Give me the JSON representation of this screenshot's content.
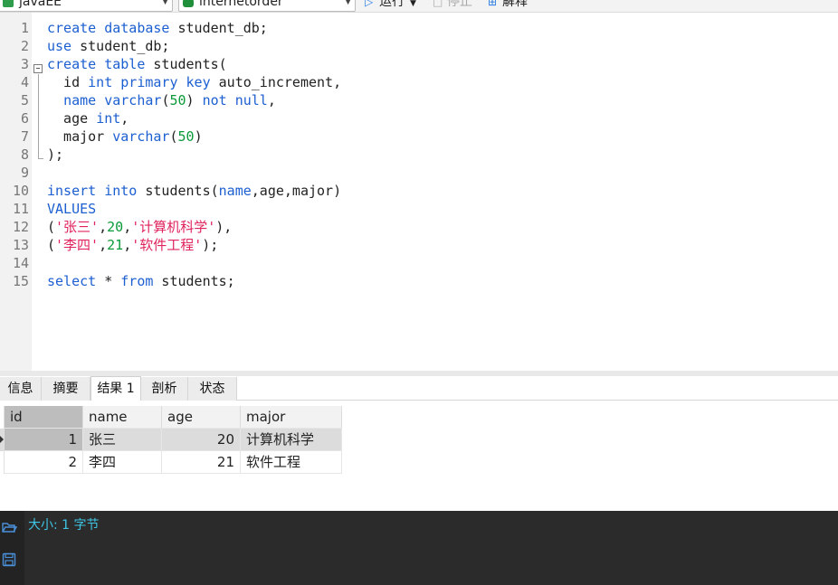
{
  "toolbar": {
    "connection": "javaEE",
    "database": "internetorder",
    "run_label": "运行",
    "stop_label": "停止",
    "explain_label": "解释"
  },
  "editor": {
    "lines": [
      {
        "n": "1",
        "t": [
          [
            "kw",
            "create database"
          ],
          [
            "p",
            " student_db;"
          ]
        ]
      },
      {
        "n": "2",
        "t": [
          [
            "kw",
            "use"
          ],
          [
            "p",
            " student_db;"
          ]
        ]
      },
      {
        "n": "3",
        "t": [
          [
            "kw",
            "create table"
          ],
          [
            "p",
            " students("
          ]
        ]
      },
      {
        "n": "4",
        "t": [
          [
            "p",
            "  id "
          ],
          [
            "kw",
            "int primary key"
          ],
          [
            "p",
            " auto_increment,"
          ]
        ]
      },
      {
        "n": "5",
        "t": [
          [
            "p",
            "  "
          ],
          [
            "kw",
            "name varchar"
          ],
          [
            "p",
            "("
          ],
          [
            "num",
            "50"
          ],
          [
            "p",
            ") "
          ],
          [
            "kw",
            "not null"
          ],
          [
            "p",
            ","
          ]
        ]
      },
      {
        "n": "6",
        "t": [
          [
            "p",
            "  age "
          ],
          [
            "kw",
            "int"
          ],
          [
            "p",
            ","
          ]
        ]
      },
      {
        "n": "7",
        "t": [
          [
            "p",
            "  major "
          ],
          [
            "kw",
            "varchar"
          ],
          [
            "p",
            "("
          ],
          [
            "num",
            "50"
          ],
          [
            "p",
            ")"
          ]
        ]
      },
      {
        "n": "8",
        "t": [
          [
            "p",
            ");"
          ]
        ]
      },
      {
        "n": "9",
        "t": []
      },
      {
        "n": "10",
        "t": [
          [
            "kw",
            "insert into"
          ],
          [
            "p",
            " students("
          ],
          [
            "kw",
            "name"
          ],
          [
            "p",
            ",age,major)"
          ]
        ]
      },
      {
        "n": "11",
        "t": [
          [
            "kw",
            "VALUES"
          ]
        ]
      },
      {
        "n": "12",
        "t": [
          [
            "p",
            "("
          ],
          [
            "str",
            "'张三'"
          ],
          [
            "p",
            ","
          ],
          [
            "num",
            "20"
          ],
          [
            "p",
            ","
          ],
          [
            "str",
            "'计算机科学'"
          ],
          [
            "p",
            "),"
          ]
        ]
      },
      {
        "n": "13",
        "t": [
          [
            "p",
            "("
          ],
          [
            "str",
            "'李四'"
          ],
          [
            "p",
            ","
          ],
          [
            "num",
            "21"
          ],
          [
            "p",
            ","
          ],
          [
            "str",
            "'软件工程'"
          ],
          [
            "p",
            ");"
          ]
        ]
      },
      {
        "n": "14",
        "t": []
      },
      {
        "n": "15",
        "t": [
          [
            "kw",
            "select"
          ],
          [
            "p",
            " * "
          ],
          [
            "kw",
            "from"
          ],
          [
            "p",
            " students;"
          ]
        ]
      }
    ]
  },
  "tabs": [
    "信息",
    "摘要",
    "结果 1",
    "剖析",
    "状态"
  ],
  "active_tab": "结果 1",
  "results": {
    "columns": [
      "id",
      "name",
      "age",
      "major"
    ],
    "rows": [
      [
        "1",
        "张三",
        "20",
        "计算机科学"
      ],
      [
        "2",
        "李四",
        "21",
        "软件工程"
      ]
    ]
  },
  "info_panel": {
    "size_text": "大小: 1 字节"
  },
  "colors": {
    "keyword": "#1c5fd1",
    "number": "#0a9a3a",
    "string": "#e0245e",
    "info_text": "#3ec6e6"
  }
}
